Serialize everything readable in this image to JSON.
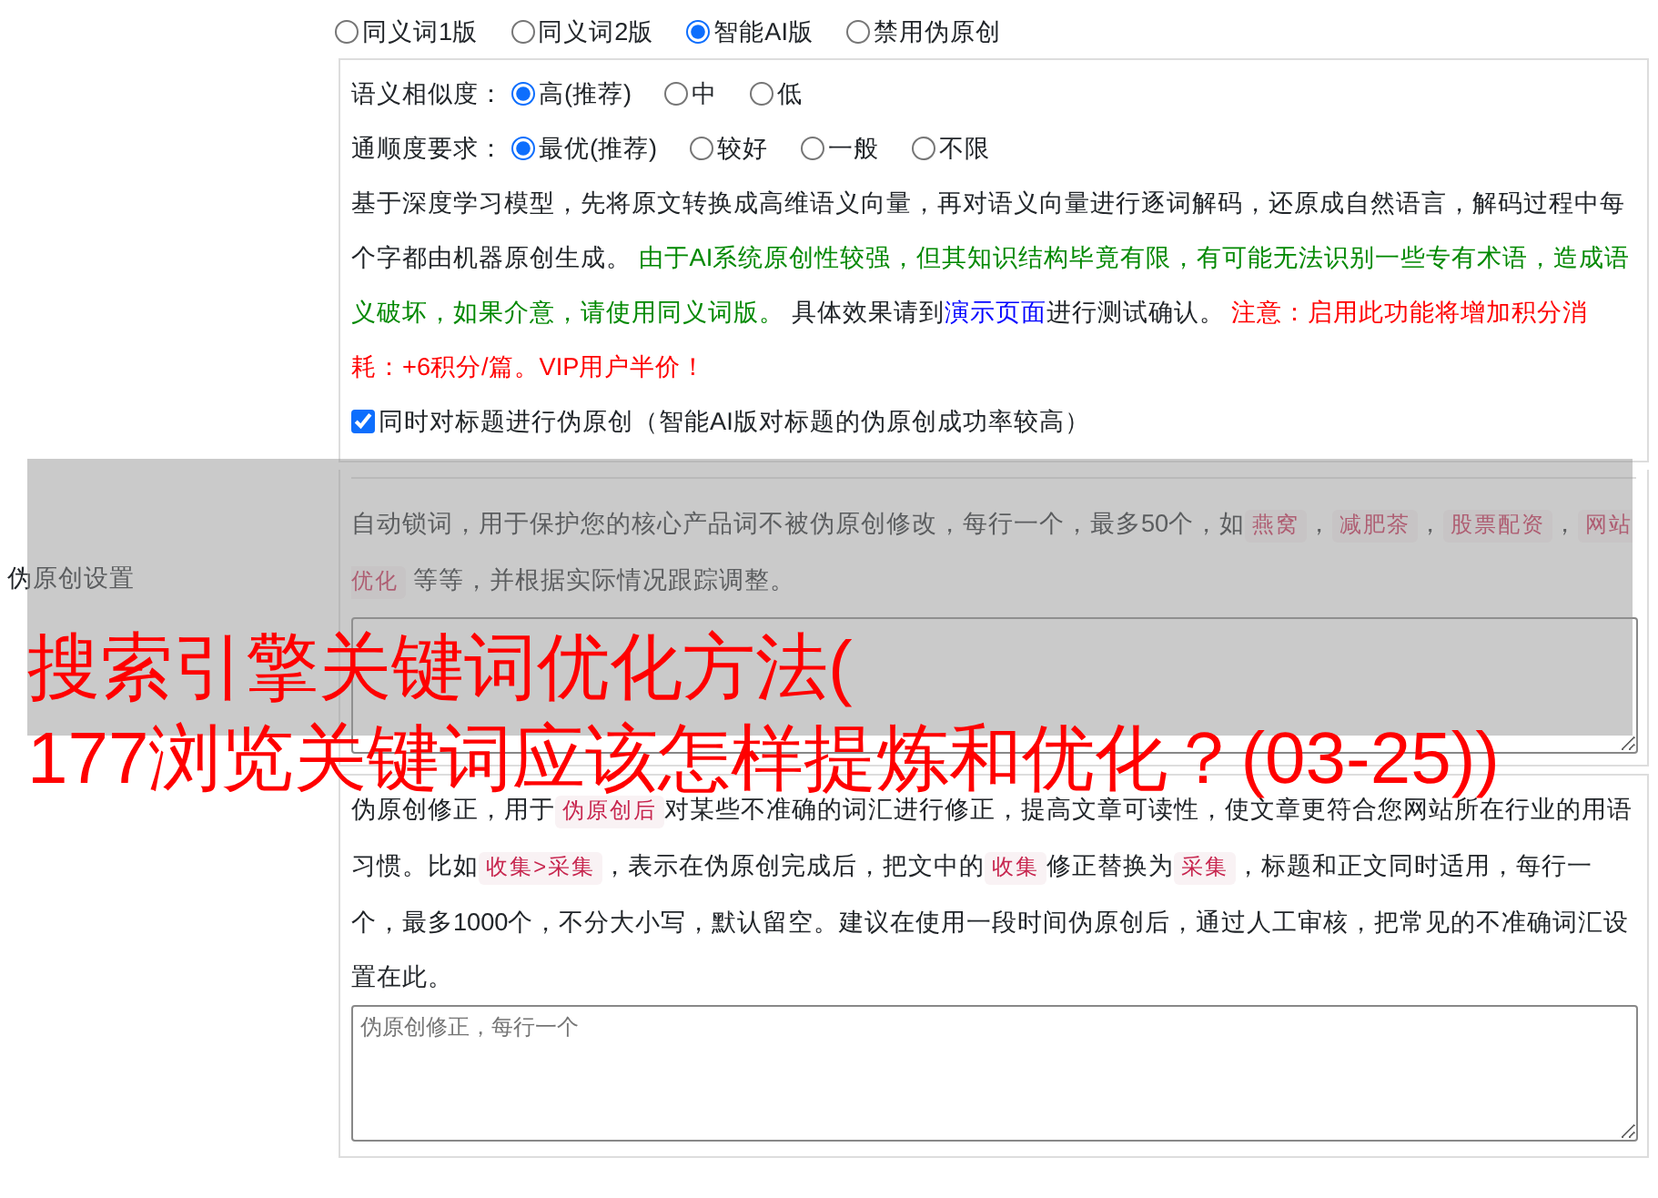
{
  "section_label": "伪原创设置",
  "mode_options": [
    {
      "label": "同义词1版",
      "selected": false
    },
    {
      "label": "同义词2版",
      "selected": false
    },
    {
      "label": "智能AI版",
      "selected": true
    },
    {
      "label": "禁用伪原创",
      "selected": false
    }
  ],
  "similarity": {
    "label": "语义相似度：",
    "options": [
      {
        "label": "高(推荐)",
        "selected": true
      },
      {
        "label": "中",
        "selected": false
      },
      {
        "label": "低",
        "selected": false
      }
    ]
  },
  "fluency": {
    "label": "通顺度要求：",
    "options": [
      {
        "label": "最优(推荐)",
        "selected": true
      },
      {
        "label": "较好",
        "selected": false
      },
      {
        "label": "一般",
        "selected": false
      },
      {
        "label": "不限",
        "selected": false
      }
    ]
  },
  "ai_description": [
    {
      "kind": "plain",
      "text": "基于深度学习模型，先将原文转换成高维语义向量，再对语义向量进行逐词解码，还原成自然语言，解码过程中每个字都由机器原创生成。 "
    },
    {
      "kind": "success",
      "text": "由于AI系统原创性较强，但其知识结构毕竟有限，有可能无法识别一些专有术语，造成语义破坏，如果介意，请使用同义词版。"
    },
    {
      "kind": "plain",
      "text": " 具体效果请到"
    },
    {
      "kind": "link",
      "text": "演示页面"
    },
    {
      "kind": "plain",
      "text": "进行测试确认。 "
    },
    {
      "kind": "warning",
      "text": "注意：启用此功能将增加积分消耗：+6积分/篇。VIP用户半价！"
    }
  ],
  "title_option": {
    "label": "同时对标题进行伪原创（智能AI版对标题的伪原创成功率较高）",
    "checked": true
  },
  "lock_words": {
    "description": [
      {
        "kind": "plain",
        "text": "自动锁词，用于保护您的核心产品词不被伪原创修改，每行一个，最多50个，如"
      },
      {
        "kind": "code",
        "text": "燕窝"
      },
      {
        "kind": "plain",
        "text": "，"
      },
      {
        "kind": "code",
        "text": "减肥茶"
      },
      {
        "kind": "plain",
        "text": "，"
      },
      {
        "kind": "code",
        "text": "股票配资"
      },
      {
        "kind": "plain",
        "text": "，"
      },
      {
        "kind": "code",
        "text": "网站优化"
      },
      {
        "kind": "plain",
        "text": " 等等，并根据实际情况跟踪调整。"
      }
    ]
  },
  "corrections": {
    "description": [
      {
        "kind": "plain",
        "text": "伪原创修正，用于"
      },
      {
        "kind": "code",
        "text": "伪原创后"
      },
      {
        "kind": "plain",
        "text": "对某些不准确的词汇进行修正，提高文章可读性，使文章更符合您网站所在行业的用语习惯。比如"
      },
      {
        "kind": "code",
        "text": "收集>采集"
      },
      {
        "kind": "plain",
        "text": "，表示在伪原创完成后，把文中的"
      },
      {
        "kind": "code",
        "text": "收集"
      },
      {
        "kind": "plain",
        "text": "修正替换为"
      },
      {
        "kind": "code",
        "text": "采集"
      },
      {
        "kind": "plain",
        "text": "，标题和正文同时适用，每行一个，最多1000个，不分大小写，默认留空。建议在使用一段时间伪原创后，通过人工审核，把常见的不准确词汇设置在此。"
      }
    ],
    "placeholder": "伪原创修正，每行一个"
  },
  "overlay_banner": {
    "lines": [
      "搜索引擎关键词优化方法(",
      "177浏览关键词应该怎样提炼和优化？(03-25))"
    ]
  }
}
